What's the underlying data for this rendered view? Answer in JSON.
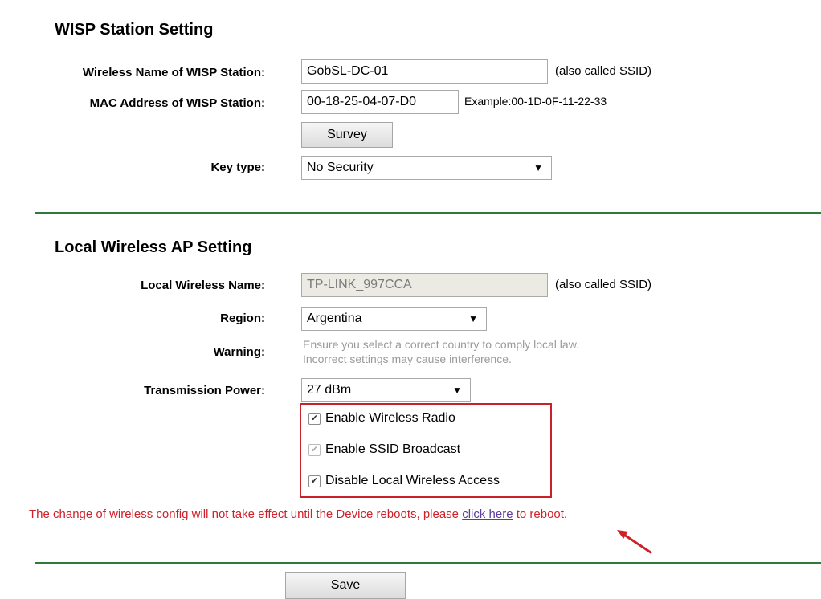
{
  "wisp_section": {
    "title": "WISP Station Setting",
    "wireless_name_label": "Wireless Name of WISP Station:",
    "wireless_name_value": "GobSL-DC-01",
    "ssid_hint": "(also called SSID)",
    "mac_label": "MAC Address of WISP Station:",
    "mac_value": "00-18-25-04-07-D0",
    "mac_example": "Example:00-1D-0F-11-22-33",
    "survey_button": "Survey",
    "key_type_label": "Key type:",
    "key_type_value": "No Security"
  },
  "local_ap_section": {
    "title": "Local Wireless AP Setting",
    "local_name_label": "Local Wireless Name:",
    "local_name_value": "TP-LINK_997CCA",
    "ssid_hint": "(also called SSID)",
    "region_label": "Region:",
    "region_value": "Argentina",
    "warning_label": "Warning:",
    "warning_line1": "Ensure you select a correct country to comply local law.",
    "warning_line2": "Incorrect settings may cause interference.",
    "power_label": "Transmission Power:",
    "power_value": "27 dBm",
    "checkboxes": [
      {
        "label": "Enable Wireless Radio",
        "checked": true,
        "disabled": false
      },
      {
        "label": "Enable SSID Broadcast",
        "checked": true,
        "disabled": true
      },
      {
        "label": "Disable Local Wireless Access",
        "checked": true,
        "disabled": false
      }
    ]
  },
  "notice": {
    "text_before": "The change of wireless config will not take effect until the Device reboots, please ",
    "link": "click here",
    "text_after": " to reboot."
  },
  "save_button": "Save",
  "colors": {
    "divider": "#2d7a3b",
    "notice_red": "#d0202a",
    "highlight_box": "#c9202a",
    "annotation_arrow": "#d0202a"
  }
}
